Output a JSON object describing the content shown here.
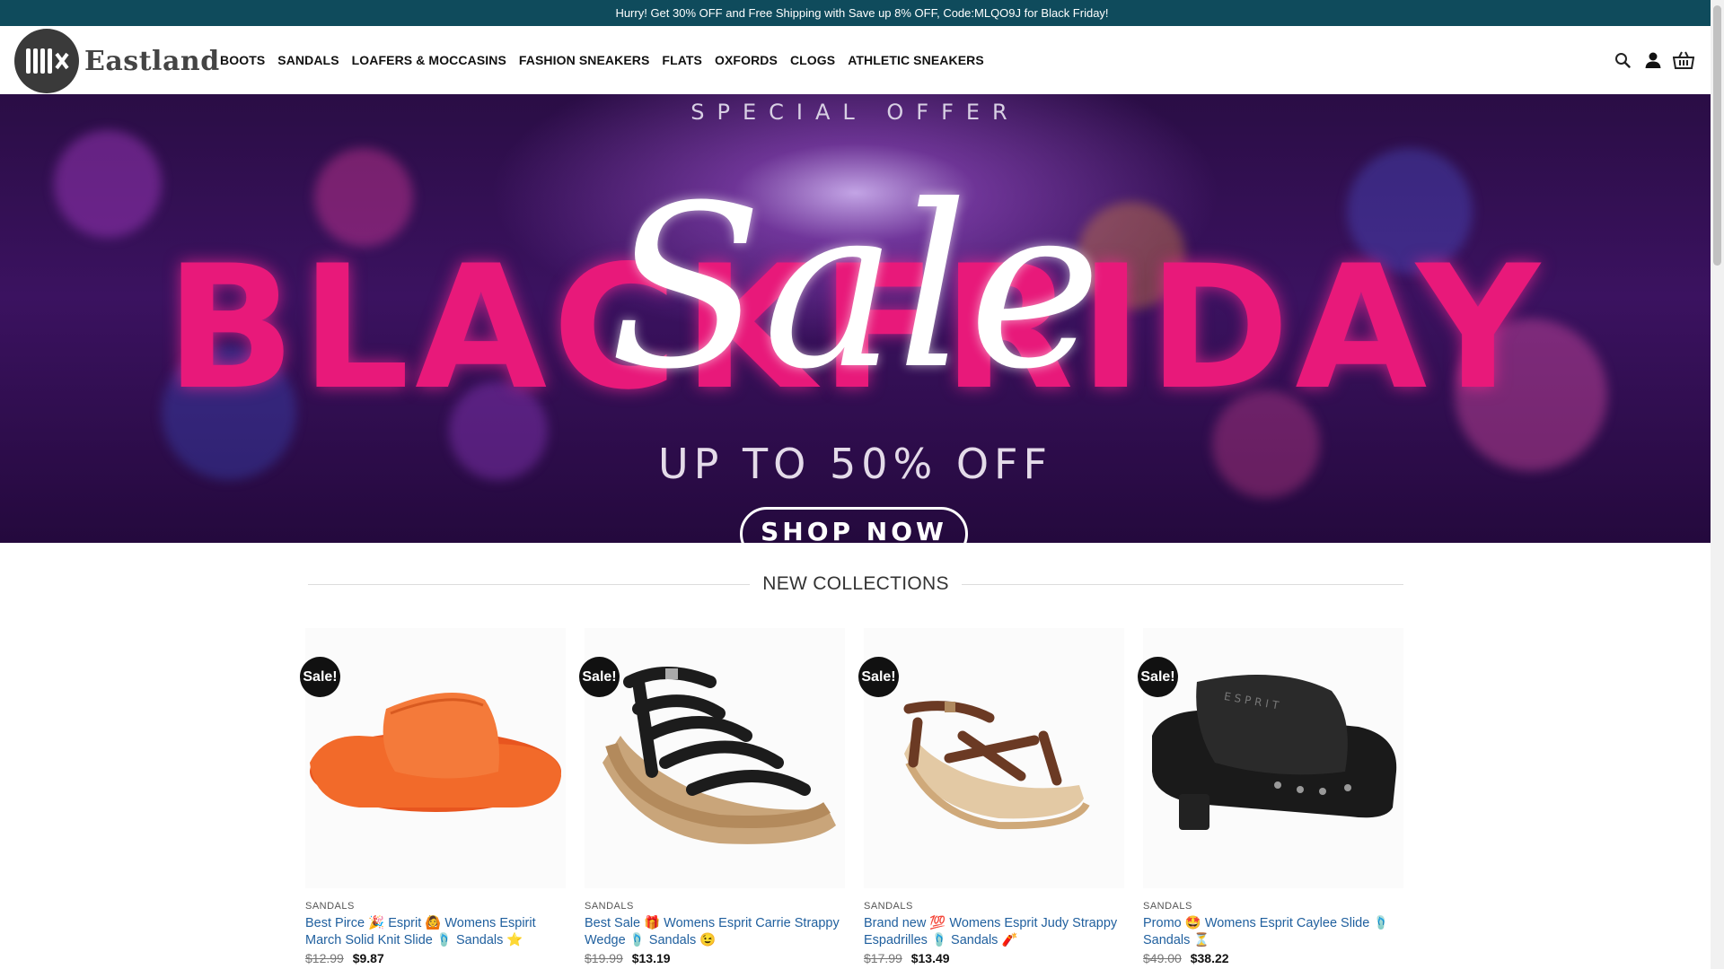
{
  "promo_bar": {
    "text": "Hurry! Get 30% OFF and Free Shipping with Save up 8% OFF, Code:MLQO9J for Black Friday!"
  },
  "header": {
    "brand": "Eastland",
    "nav": [
      "BOOTS",
      "SANDALS",
      "LOAFERS & MOCCASINS",
      "FASHION SNEAKERS",
      "FLATS",
      "OXFORDS",
      "CLOGS",
      "ATHLETIC SNEAKERS"
    ],
    "icons": [
      "search-icon",
      "user-icon",
      "basket-icon"
    ]
  },
  "hero": {
    "special": "SPECIAL OFFER",
    "black": "BLACKFRIDAY",
    "sale": "Sale",
    "discount": "UP TO 50% OFF",
    "cta": "SHOP NOW"
  },
  "section": {
    "title": "NEW COLLECTIONS"
  },
  "products": [
    {
      "badge": "Sale!",
      "category": "SANDALS",
      "name": "Best Pirce 🎉 Esprit 🙆 Womens Espirit March Solid Knit Slide 🩴 Sandals ⭐",
      "old_price": "$12.99",
      "price": "$9.87",
      "color": "#f26a2a"
    },
    {
      "badge": "Sale!",
      "category": "SANDALS",
      "name": "Best Sale 🎁 Womens Esprit Carrie Strappy Wedge 🩴 Sandals 😉",
      "old_price": "$19.99",
      "price": "$13.19",
      "color": "#1c1c1c"
    },
    {
      "badge": "Sale!",
      "category": "SANDALS",
      "name": "Brand new 💯 Womens Esprit Judy Strappy Espadrilles 🩴 Sandals 🧨",
      "old_price": "$17.99",
      "price": "$13.49",
      "color": "#6b3a24"
    },
    {
      "badge": "Sale!",
      "category": "SANDALS",
      "name": "Promo 🤩 Womens Esprit Caylee Slide 🩴 Sandals ⏳",
      "old_price": "$49.00",
      "price": "$38.22",
      "color": "#1a1a1a"
    }
  ],
  "colors": {
    "promo_bar": "#0f4b5c",
    "link": "#1f5f9e",
    "hero_pink": "#e8197a"
  }
}
